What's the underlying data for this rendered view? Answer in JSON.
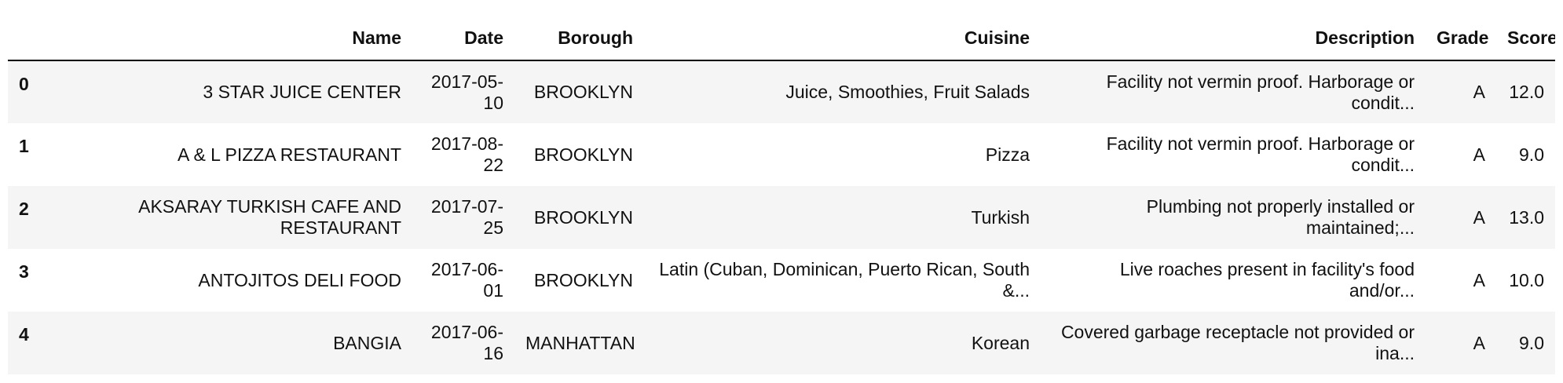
{
  "table": {
    "index_header": "",
    "columns": [
      "Name",
      "Date",
      "Borough",
      "Cuisine",
      "Description",
      "Grade",
      "Score"
    ],
    "rows": [
      {
        "index": "0",
        "name": "3 STAR JUICE CENTER",
        "date": "2017-05-10",
        "borough": "BROOKLYN",
        "cuisine": "Juice, Smoothies, Fruit Salads",
        "description": "Facility not vermin proof. Harborage or condit...",
        "grade": "A",
        "score": "12.0"
      },
      {
        "index": "1",
        "name": "A & L PIZZA RESTAURANT",
        "date": "2017-08-22",
        "borough": "BROOKLYN",
        "cuisine": "Pizza",
        "description": "Facility not vermin proof. Harborage or condit...",
        "grade": "A",
        "score": "9.0"
      },
      {
        "index": "2",
        "name": "AKSARAY TURKISH CAFE AND RESTAURANT",
        "date": "2017-07-25",
        "borough": "BROOKLYN",
        "cuisine": "Turkish",
        "description": "Plumbing not properly installed or maintained;...",
        "grade": "A",
        "score": "13.0"
      },
      {
        "index": "3",
        "name": "ANTOJITOS DELI FOOD",
        "date": "2017-06-01",
        "borough": "BROOKLYN",
        "cuisine": "Latin (Cuban, Dominican, Puerto Rican, South &...",
        "description": "Live roaches present in facility's food and/or...",
        "grade": "A",
        "score": "10.0"
      },
      {
        "index": "4",
        "name": "BANGIA",
        "date": "2017-06-16",
        "borough": "MANHATTAN",
        "cuisine": "Korean",
        "description": "Covered garbage receptacle not provided or ina...",
        "grade": "A",
        "score": "9.0"
      }
    ]
  }
}
